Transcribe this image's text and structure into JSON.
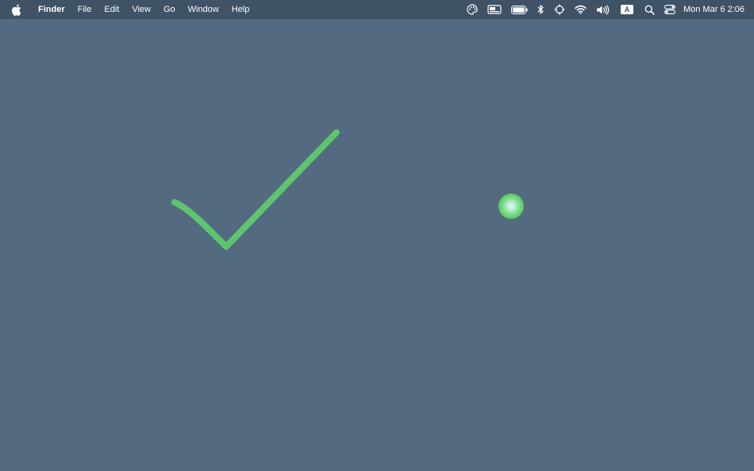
{
  "menubar": {
    "app_name": "Finder",
    "menus": [
      "File",
      "Edit",
      "View",
      "Go",
      "Window",
      "Help"
    ],
    "input_source": "A",
    "clock": "Mon Mar 6  2:06"
  },
  "icons": {
    "apple": "apple-logo-icon",
    "status": [
      "palette-icon",
      "display-icon",
      "battery-icon",
      "bluetooth-icon",
      "crosshair-icon",
      "wifi-icon",
      "volume-icon",
      "input-source-icon",
      "search-icon",
      "control-center-icon"
    ]
  },
  "colors": {
    "desktop": "#546a80",
    "menubar": "#3f5266",
    "checkmark": "#5ec46e",
    "cursor_highlight": "#5ccf6a"
  }
}
